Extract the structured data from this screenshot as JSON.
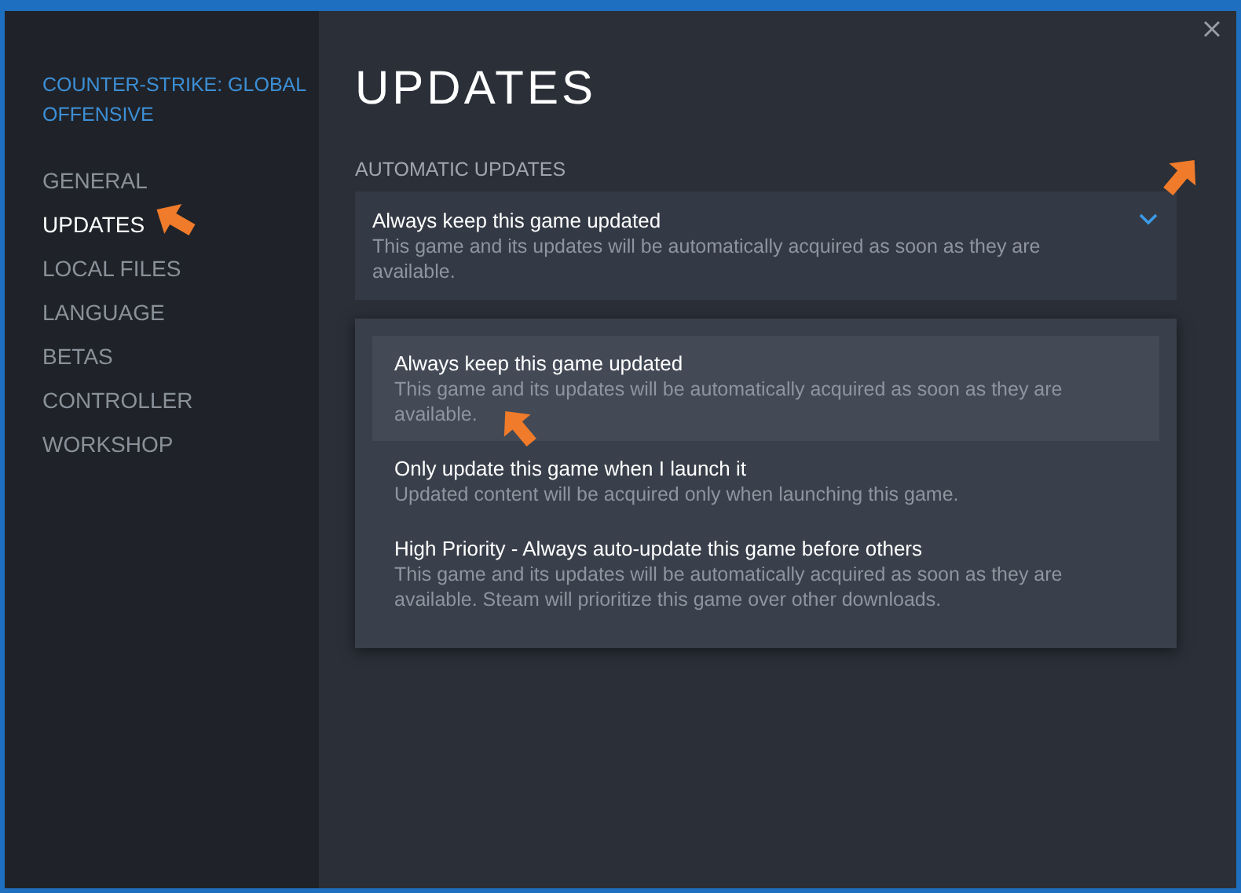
{
  "sidebar": {
    "game_title": "COUNTER-STRIKE: GLOBAL OFFENSIVE",
    "items": [
      {
        "label": "GENERAL",
        "selected": false
      },
      {
        "label": "UPDATES",
        "selected": true
      },
      {
        "label": "LOCAL FILES",
        "selected": false
      },
      {
        "label": "LANGUAGE",
        "selected": false
      },
      {
        "label": "BETAS",
        "selected": false
      },
      {
        "label": "CONTROLLER",
        "selected": false
      },
      {
        "label": "WORKSHOP",
        "selected": false
      }
    ]
  },
  "page_title": "UPDATES",
  "section_label": "AUTOMATIC UPDATES",
  "dropdown": {
    "value": "Always keep this game updated",
    "description": "This game and its updates will be automatically acquired as soon as they are available.",
    "expanded": true,
    "options": [
      {
        "title": "Always keep this game updated",
        "description": "This game and its updates will be automatically acquired as soon as they are available.",
        "selected": true
      },
      {
        "title": "Only update this game when I launch it",
        "description": "Updated content will be acquired only when launching this game.",
        "selected": false
      },
      {
        "title": "High Priority - Always auto-update this game before others",
        "description": "This game and its updates will be automatically acquired as soon as they are available. Steam will prioritize this game over other downloads.",
        "selected": false
      }
    ]
  }
}
